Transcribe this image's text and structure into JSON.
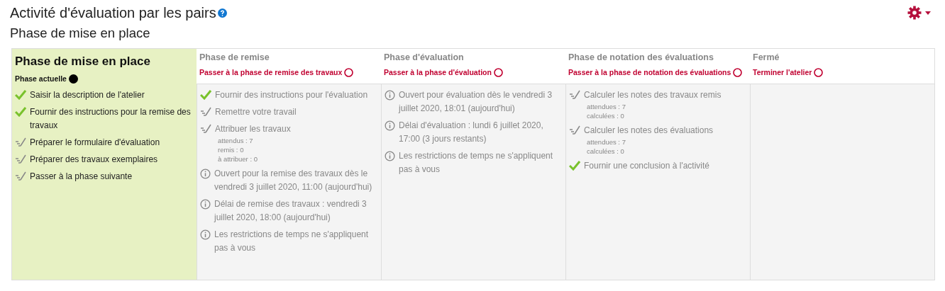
{
  "page": {
    "title": "Activité d'évaluation par les pairs",
    "subtitle": "Phase de mise en place"
  },
  "phases": [
    {
      "title": "Phase de mise en place",
      "selected": true,
      "status": "Phase actuelle",
      "tasks": [
        {
          "kind": "done",
          "text": "Saisir la description de l'atelier"
        },
        {
          "kind": "done",
          "text": "Fournir des instructions pour la remise des travaux"
        },
        {
          "kind": "todo",
          "text": "Préparer le formulaire d'évaluation"
        },
        {
          "kind": "todo",
          "text": "Préparer des travaux exemplaires"
        },
        {
          "kind": "todo",
          "text": "Passer à la phase suivante"
        }
      ]
    },
    {
      "title": "Phase de remise",
      "selected": false,
      "action": "Passer à la phase de remise des travaux",
      "tasks": [
        {
          "kind": "done",
          "text": "Fournir des instructions pour l'évaluation"
        },
        {
          "kind": "todo",
          "text": "Remettre votre travail"
        },
        {
          "kind": "todo",
          "text": "Attribuer les travaux",
          "details": [
            "attendus : 7",
            "remis : 0",
            "à attribuer : 0"
          ]
        },
        {
          "kind": "info",
          "text": "Ouvert pour la remise des travaux dès le vendredi 3 juillet 2020, 11:00 (aujourd'hui)"
        },
        {
          "kind": "info",
          "text": "Délai de remise des travaux : vendredi 3 juillet 2020, 18:00 (aujourd'hui)"
        },
        {
          "kind": "info",
          "text": "Les restrictions de temps ne s'appliquent pas à vous"
        }
      ]
    },
    {
      "title": "Phase d'évaluation",
      "selected": false,
      "action": "Passer à la phase d'évaluation",
      "tasks": [
        {
          "kind": "info",
          "text": "Ouvert pour évaluation dès le vendredi 3 juillet 2020, 18:01 (aujourd'hui)"
        },
        {
          "kind": "info",
          "text": "Délai d'évaluation : lundi 6 juillet 2020, 17:00 (3 jours restants)"
        },
        {
          "kind": "info",
          "text": "Les restrictions de temps ne s'appliquent pas à vous"
        }
      ]
    },
    {
      "title": "Phase de notation des évaluations",
      "selected": false,
      "action": "Passer à la phase de notation des évaluations",
      "tasks": [
        {
          "kind": "todo",
          "text": "Calculer les notes des travaux remis",
          "details": [
            "attendues : 7",
            "calculées : 0"
          ]
        },
        {
          "kind": "todo",
          "text": "Calculer les notes des évaluations",
          "details": [
            "attendues : 7",
            "calculées : 0"
          ]
        },
        {
          "kind": "done",
          "text": "Fournir une conclusion à l'activité"
        }
      ]
    },
    {
      "title": "Fermé",
      "selected": false,
      "action": "Terminer l'atelier"
    }
  ]
}
